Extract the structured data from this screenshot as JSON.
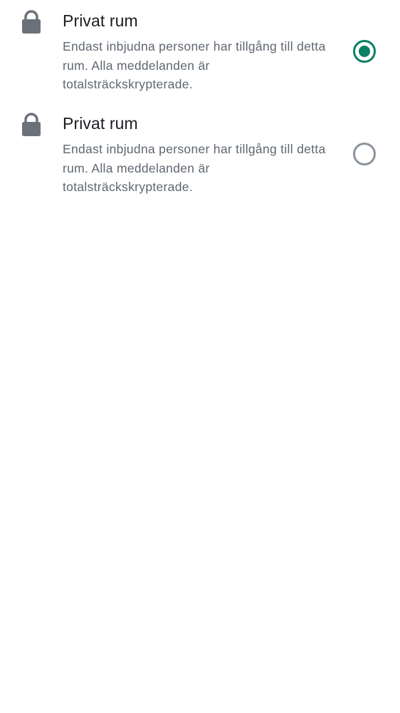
{
  "options": [
    {
      "icon": "lock-icon",
      "title": "Privat rum",
      "description": "Endast inbjudna personer har tillgång till detta rum. Alla meddelanden är totalsträckskrypterade.",
      "selected": true
    },
    {
      "icon": "lock-icon",
      "title": "Privat rum",
      "description": "Endast inbjudna personer har tillgång till detta rum. Alla meddelanden är totalsträckskrypterade.",
      "selected": false
    }
  ],
  "colors": {
    "accent": "#0b7e64",
    "icon": "#6b717a",
    "title": "#1b1d22",
    "description": "#5f6670",
    "radio_unselected": "#8d939c"
  }
}
